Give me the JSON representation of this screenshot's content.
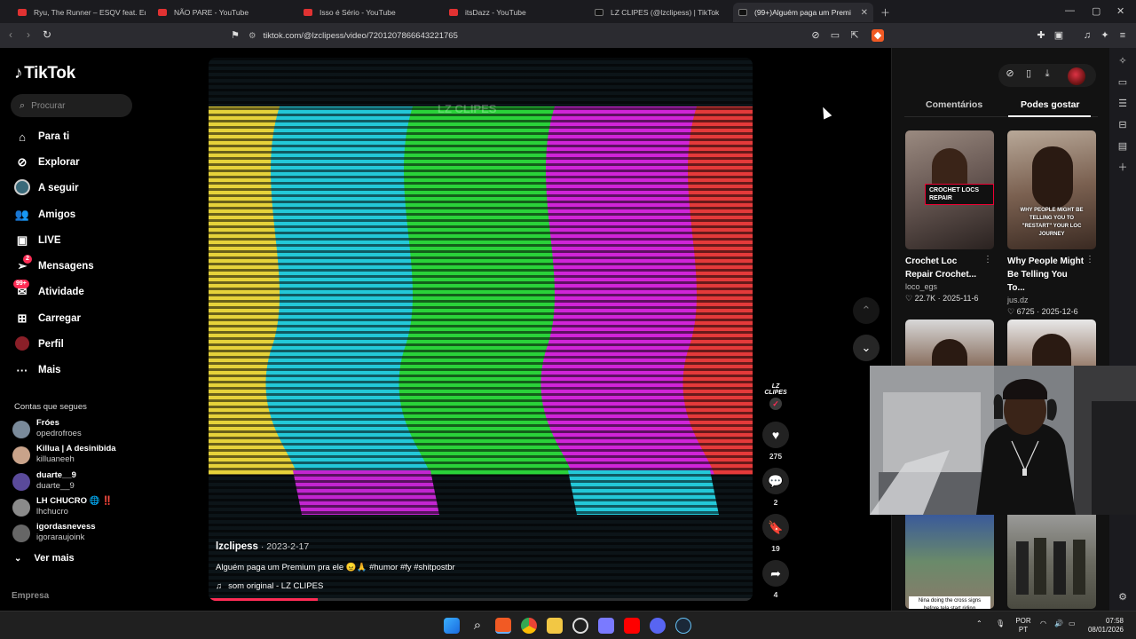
{
  "browser": {
    "tabs": [
      {
        "title": "Ryu, The Runner – ESQV feat. Emité",
        "icon": "youtube-icon"
      },
      {
        "title": "NÃO PARE - YouTube",
        "icon": "youtube-icon"
      },
      {
        "title": "Isso é Sério - YouTube",
        "icon": "youtube-icon"
      },
      {
        "title": "itsDazz - YouTube",
        "icon": "youtube-icon"
      },
      {
        "title": "LZ CLIPES (@lzclipess) | TikTok",
        "icon": "tiktok-icon"
      },
      {
        "title": "(99+)Alguém paga um Premi",
        "icon": "tiktok-icon",
        "active": true
      }
    ],
    "url": "tiktok.com/@lzclipess/video/7201207866643221765"
  },
  "sidebar": {
    "logo": "TikTok",
    "search_placeholder": "Procurar",
    "nav": [
      {
        "label": "Para ti",
        "icon": "home-icon"
      },
      {
        "label": "Explorar",
        "icon": "compass-icon"
      },
      {
        "label": "A seguir",
        "icon": "following-icon"
      },
      {
        "label": "Amigos",
        "icon": "friends-icon"
      },
      {
        "label": "LIVE",
        "icon": "live-icon"
      },
      {
        "label": "Mensagens",
        "icon": "messages-icon",
        "badge": "2"
      },
      {
        "label": "Atividade",
        "icon": "activity-icon",
        "badge": "99+"
      },
      {
        "label": "Carregar",
        "icon": "upload-icon"
      },
      {
        "label": "Perfil",
        "icon": "profile-icon"
      },
      {
        "label": "Mais",
        "icon": "more-icon"
      }
    ],
    "following_title": "Contas que segues",
    "following": [
      {
        "name": "Fróes",
        "user": "opedrofroes",
        "color": "#7a8a9a"
      },
      {
        "name": "Killua | A desinibida",
        "user": "killuaneeh",
        "color": "#c9a38a"
      },
      {
        "name": "duarte__9",
        "user": "duarte__9",
        "color": "#5a4a9a"
      },
      {
        "name": "LH CHUCRO 🌐 ‼️",
        "user": "lhchucro",
        "color": "#8a8a8a"
      },
      {
        "name": "igordasnevess",
        "user": "igoraraujoink",
        "color": "#666666"
      }
    ],
    "see_more": "Ver mais",
    "footer_label": "Empresa"
  },
  "video": {
    "watermark": "LZ CLIPES",
    "author": "lzclipess",
    "date": "2023-2-17",
    "caption": "Alguém paga um Premium pra ele 😠🙏 #humor #fy #shitpostbr",
    "sound": "som original - LZ CLIPES",
    "progress": 0.2
  },
  "actions": {
    "avatar_text": "LZ CLIPES",
    "likes": "275",
    "comments": "2",
    "saves": "19",
    "shares": "4"
  },
  "right_panel": {
    "tabs": [
      "Comentários",
      "Podes gostar"
    ],
    "cards": [
      {
        "title": "Crochet Loc Repair Crochet...",
        "author": "loco_egs",
        "likes": "22.7K",
        "date": "2025-11-6",
        "tag": "CROCHET LOCS REPAIR"
      },
      {
        "title": "Why People Might Be Telling You To...",
        "author": "jus.dz",
        "likes": "6725",
        "date": "2025-12-6",
        "tag": "WHY PEOPLE MIGHT BE TELLING YOU TO \"RESTART\" YOUR LOC JOURNEY"
      }
    ],
    "bottom_caption": "Nina doing the cross signs before tela start riding"
  },
  "taskbar": {
    "lang_top": "POR",
    "lang_bottom": "PT",
    "time": "07:58",
    "date": "08/01/2026"
  }
}
